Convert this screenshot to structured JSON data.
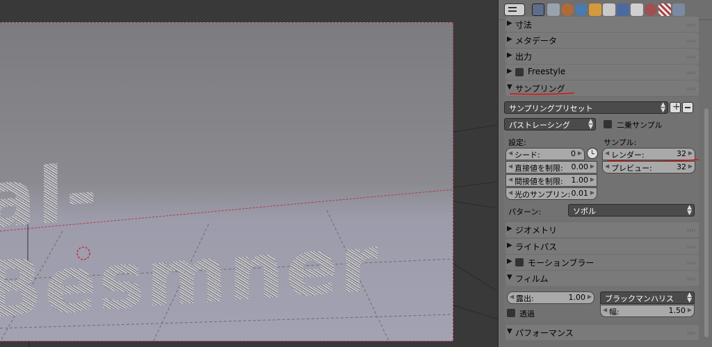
{
  "panel": {
    "sections": {
      "dimensions": "寸法",
      "metadata": "メタデータ",
      "output": "出力",
      "freestyle": "Freestyle",
      "sampling": "サンプリング",
      "geometry": "ジオメトリ",
      "light_paths": "ライトパス",
      "motion_blur": "モーションブラー",
      "film": "フィルム",
      "performance": "パフォーマンス"
    },
    "sampling": {
      "preset": "サンプリングプリセット",
      "integrator": "パストレーシング",
      "squared_samples": "二乗サンプル",
      "settings_label": "設定:",
      "samples_label": "サンプル:",
      "seed": {
        "label": "シード:",
        "value": "0"
      },
      "clamp_direct": {
        "label": "直接値を制限:",
        "value": "0.00"
      },
      "clamp_indirect": {
        "label": "間接値を制限:",
        "value": "1.00"
      },
      "light_sampling": {
        "label": "光のサンプリン:",
        "value": "0.01"
      },
      "render": {
        "label": "レンダー:",
        "value": "32"
      },
      "preview": {
        "label": "プレビュー:",
        "value": "32"
      },
      "pattern_label": "パターン:",
      "pattern": "ソボル"
    },
    "film": {
      "exposure": {
        "label": "露出:",
        "value": "1.00"
      },
      "transparent": "透過",
      "filter": "ブラックマンハリス",
      "width": {
        "label": "幅:",
        "value": "1.50"
      }
    }
  },
  "viewport": {
    "text_object": "al-Besmner"
  },
  "colors": {
    "annotation_red": "#e01010",
    "panel_bg": "#6f6f6f",
    "dark_button": "#4b4b4b"
  }
}
